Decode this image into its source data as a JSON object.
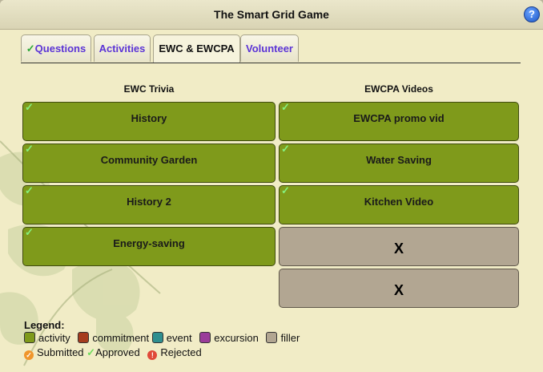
{
  "window": {
    "title": "The Smart Grid Game",
    "help_icon": "?"
  },
  "tabs": [
    {
      "label": "Questions",
      "approved_mark": "✓"
    },
    {
      "label": "Activities"
    },
    {
      "label": "EWC & EWCPA",
      "active": true
    },
    {
      "label": "Volunteer"
    }
  ],
  "columns": {
    "left": {
      "heading": "EWC Trivia",
      "items": [
        {
          "label": "History",
          "status": "approved",
          "type": "activity"
        },
        {
          "label": "Community Garden",
          "status": "approved",
          "type": "activity"
        },
        {
          "label": "History 2",
          "status": "approved",
          "type": "activity"
        },
        {
          "label": "Energy-saving",
          "status": "approved",
          "type": "activity"
        }
      ]
    },
    "right": {
      "heading": "EWCPA Videos",
      "items": [
        {
          "label": "EWCPA promo vid",
          "status": "approved",
          "type": "activity"
        },
        {
          "label": "Water Saving",
          "status": "approved",
          "type": "activity"
        },
        {
          "label": "Kitchen Video",
          "status": "approved",
          "type": "activity"
        },
        {
          "label": "X",
          "type": "filler"
        },
        {
          "label": "X",
          "type": "filler"
        }
      ]
    }
  },
  "check_mark": "✓",
  "legend": {
    "title": "Legend:",
    "types": [
      {
        "label": "activity",
        "color": "#7f9a1b"
      },
      {
        "label": "commitment",
        "color": "#a63c1e"
      },
      {
        "label": "event",
        "color": "#2f8f8f"
      },
      {
        "label": "excursion",
        "color": "#9a3c9a"
      },
      {
        "label": "filler",
        "color": "#b2a692"
      }
    ],
    "statuses": [
      {
        "label": "Submitted",
        "color": "#f0962c"
      },
      {
        "label": "Approved",
        "color": "#6fdc5d"
      },
      {
        "label": "Rejected",
        "color": "#e04a3a"
      }
    ]
  }
}
